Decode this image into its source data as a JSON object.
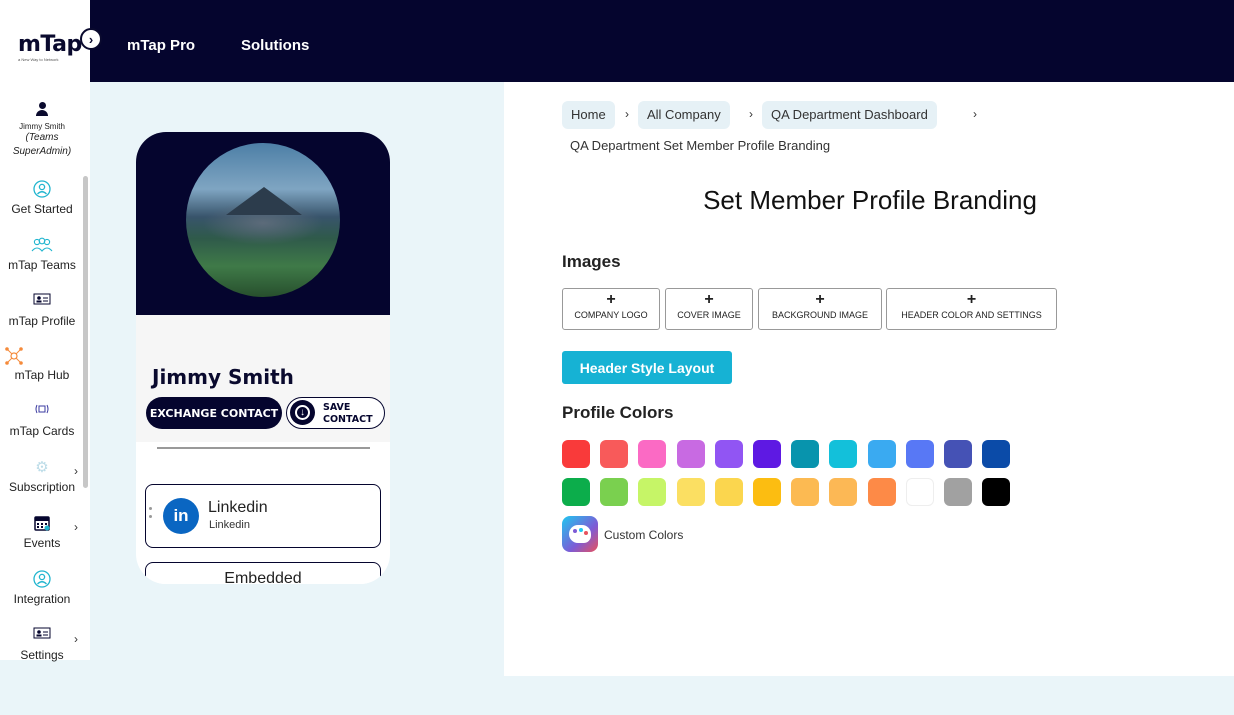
{
  "brand": {
    "logo": "mTap",
    "tagline": "a New Way to Network"
  },
  "topbar": {
    "items": [
      "mTap Pro",
      "Solutions"
    ]
  },
  "sidebar": {
    "user": {
      "name": "Jimmy Smith",
      "role_line1": "(Teams",
      "role_line2": "SuperAdmin)"
    },
    "items": [
      {
        "label": "Get Started",
        "icon": "user-circle-icon"
      },
      {
        "label": "mTap Teams",
        "icon": "team-icon"
      },
      {
        "label": "mTap Profile",
        "icon": "id-card-icon"
      },
      {
        "label": "mTap Hub",
        "icon": "hub-network-icon"
      },
      {
        "label": "mTap Cards",
        "icon": "nfc-card-icon"
      },
      {
        "label": "Subscription",
        "icon": "gear-icon"
      },
      {
        "label": "Events",
        "icon": "calendar-icon"
      },
      {
        "label": "Integration",
        "icon": "user-circle-icon"
      },
      {
        "label": "Settings",
        "icon": "id-card-icon"
      }
    ]
  },
  "breadcrumb": {
    "items": [
      "Home",
      "All Company",
      "QA Department Dashboard"
    ],
    "current": "QA Department Set Member Profile Branding"
  },
  "page": {
    "title": "Set Member Profile Branding",
    "images_heading": "Images",
    "image_buttons": [
      "COMPANY LOGO",
      "COVER IMAGE",
      "BACKGROUND IMAGE",
      "HEADER COLOR AND SETTINGS"
    ],
    "header_style_button": "Header Style Layout",
    "colors_heading": "Profile Colors",
    "custom_colors_label": "Custom Colors",
    "colors_row1": [
      "#f93a3a",
      "#f85a5a",
      "#fb6ac4",
      "#c86ae2",
      "#9155f3",
      "#5e19e3",
      "#0894ad",
      "#13c0da",
      "#3aaaf1",
      "#5878f5",
      "#4552b5",
      "#0b4ba8"
    ],
    "colors_row2": [
      "#0cad4b",
      "#7ad04f",
      "#c6f567",
      "#fbdf62",
      "#fbd64e",
      "#fcbd11",
      "#fcba52",
      "#fcb855",
      "#fd8a47",
      "#ffffff",
      "#a1a1a1",
      "#000000"
    ]
  },
  "preview": {
    "name": "Jimmy Smith",
    "exchange_button": "EXCHANGE CONTACT",
    "save_line1": "SAVE",
    "save_line2": "CONTACT",
    "link_title": "Linkedin",
    "link_subtitle": "Linkedin",
    "link_icon_text": "in",
    "embed_title": "Embedded"
  },
  "colors": {
    "topbar": "#05052e",
    "accent": "#16b2d4",
    "linkedin": "#0a66c2"
  }
}
